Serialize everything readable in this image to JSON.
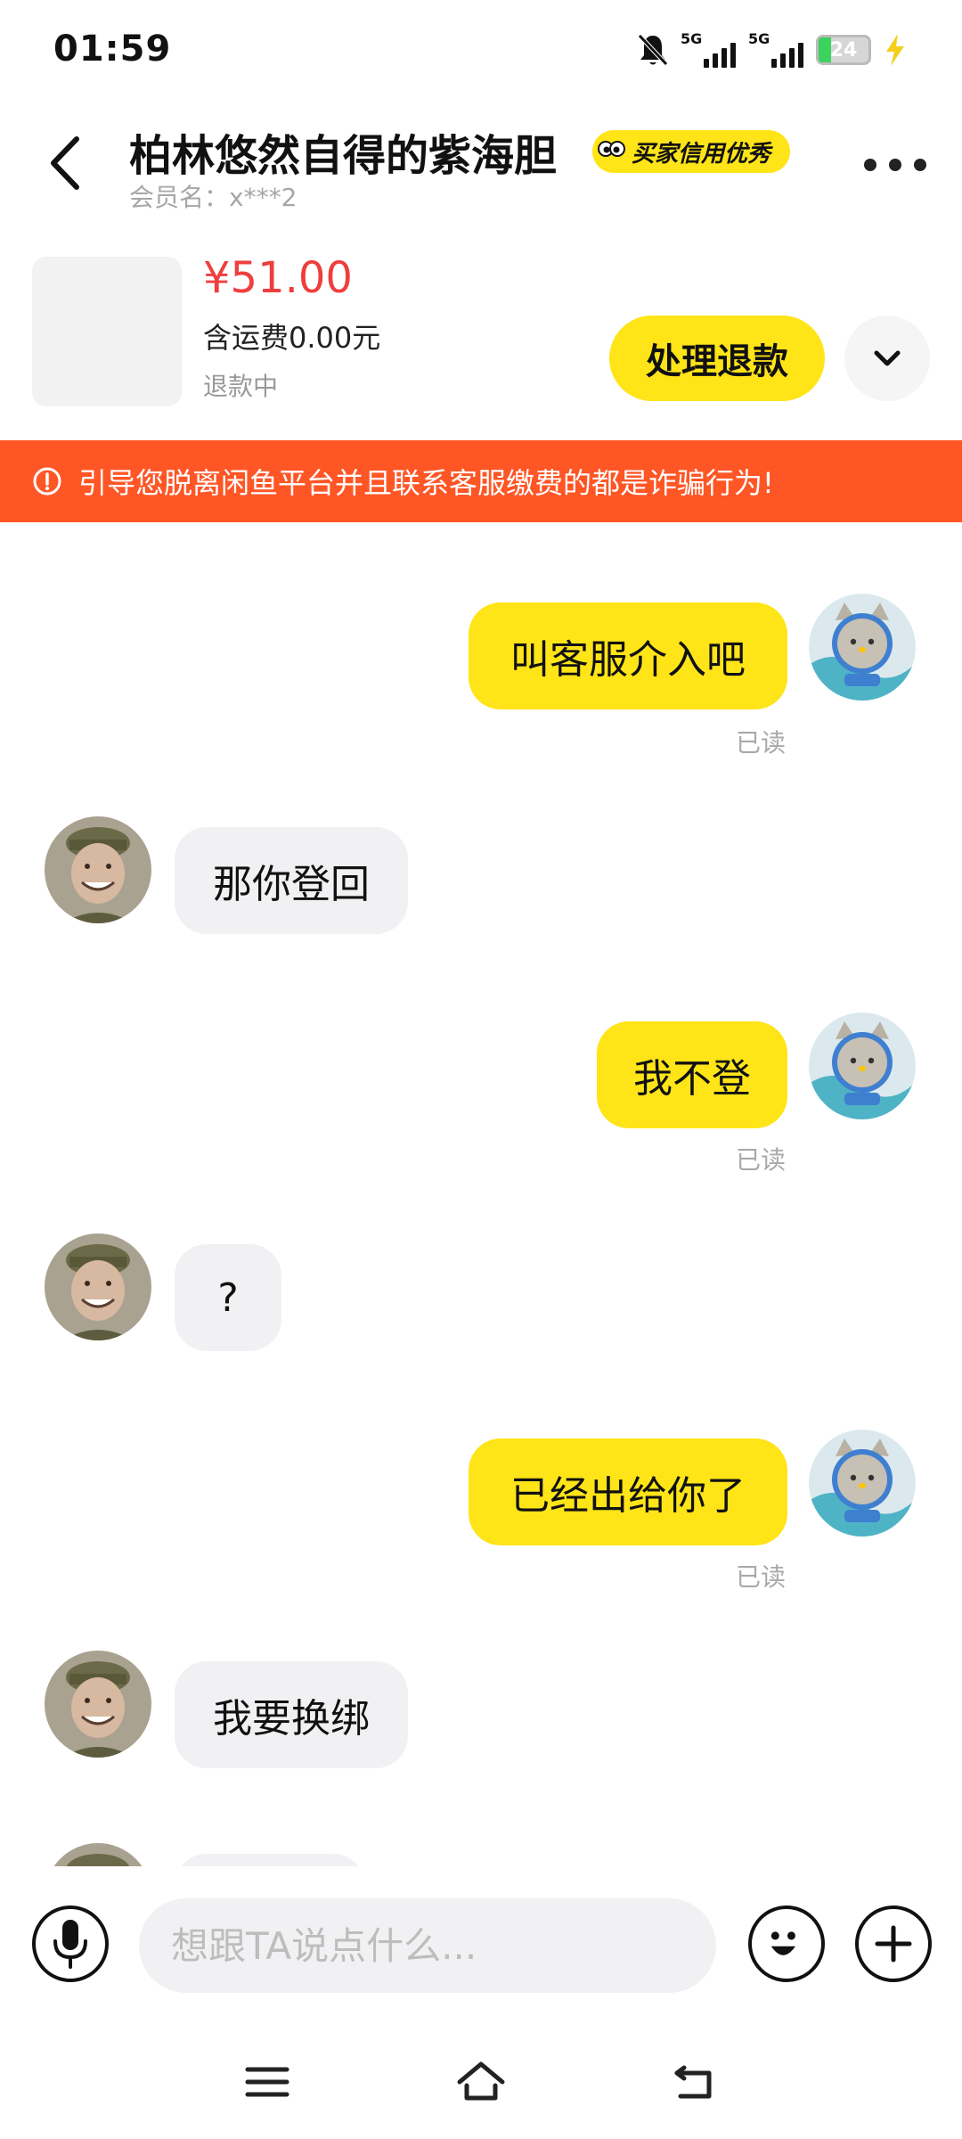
{
  "status_bar": {
    "time": "01:59",
    "network_1": "5G",
    "network_2": "5G",
    "battery": "24",
    "icons": [
      "bell-off-icon",
      "signal-icon",
      "signal-icon",
      "battery-icon",
      "charging-icon"
    ]
  },
  "header": {
    "seller_name": "柏林悠然自得的紫海胆",
    "credit_badge": "买家信用优秀",
    "member_label": "会员名：x***2"
  },
  "product": {
    "price": "¥51.00",
    "shipping": "含运费0.00元",
    "status": "退款中",
    "action_label": "处理退款"
  },
  "warning": {
    "text": "引导您脱离闲鱼平台并且联系客服缴费的都是诈骗行为!"
  },
  "messages": [
    {
      "sender": "me",
      "text": "叫客服介入吧",
      "status": "已读"
    },
    {
      "sender": "other",
      "text": "那你登回"
    },
    {
      "sender": "me",
      "text": "我不登",
      "status": "已读"
    },
    {
      "sender": "other",
      "text": "?"
    },
    {
      "sender": "me",
      "text": "已经出给你了",
      "status": "已读"
    },
    {
      "sender": "other",
      "text": "我要换绑"
    }
  ],
  "input": {
    "placeholder": "想跟TA说点什么..."
  },
  "colors": {
    "accent_yellow": "#ffe418",
    "price_red": "#ef3e3e",
    "warning_orange": "#ff5626",
    "bubble_gray": "#f1f1f3"
  }
}
